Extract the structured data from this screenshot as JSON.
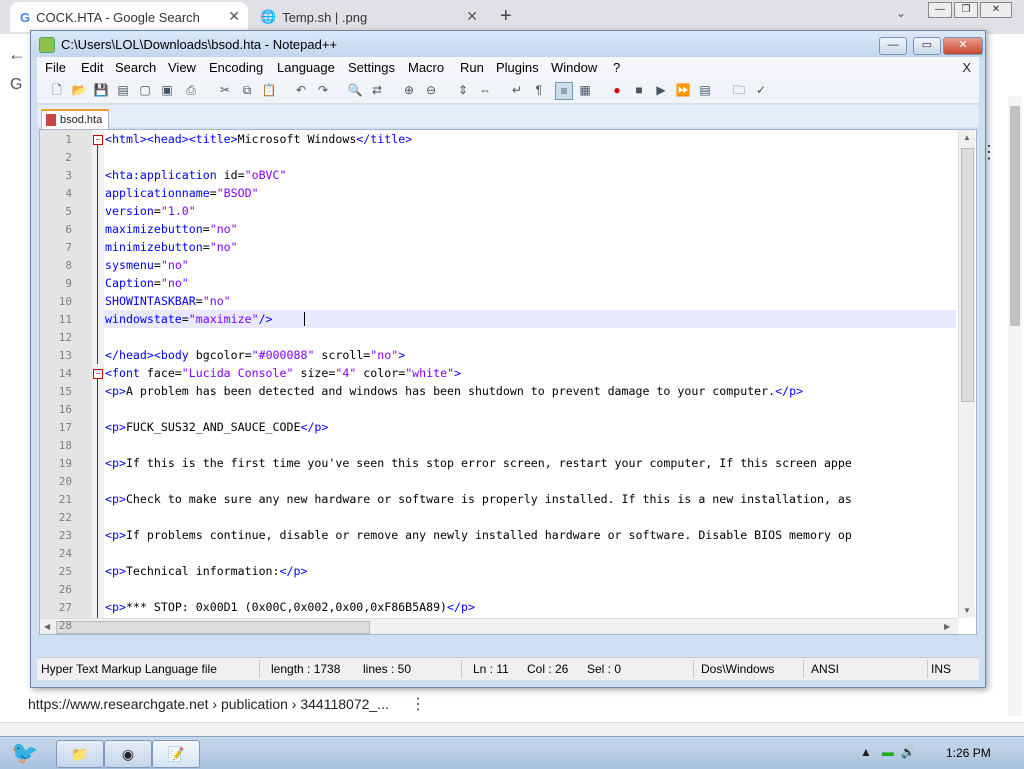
{
  "browser": {
    "tabs": [
      {
        "title": "COCK.HTA - Google Search",
        "icon": "google-g-icon"
      },
      {
        "title": "Temp.sh | .png",
        "icon": "globe-icon"
      }
    ],
    "new_tab": "+",
    "tab_search": "⌄",
    "result_url": "https://www.researchgate.net › publication › 344118072_...",
    "more": "⋮"
  },
  "npp": {
    "title": "C:\\Users\\LOL\\Downloads\\bsod.hta - Notepad++",
    "menu": [
      "File",
      "Edit",
      "Search",
      "View",
      "Encoding",
      "Language",
      "Settings",
      "Macro",
      "Run",
      "Plugins",
      "Window",
      "?"
    ],
    "menu_close": "X",
    "file_tab": "bsod.hta",
    "lines": [
      {
        "n": "1",
        "text": "<html><head><title>Microsoft Windows</title>"
      },
      {
        "n": "2",
        "text": ""
      },
      {
        "n": "3",
        "text": "<hta:application id=\"oBVC\""
      },
      {
        "n": "4",
        "text": "applicationname=\"BSOD\""
      },
      {
        "n": "5",
        "text": "version=\"1.0\""
      },
      {
        "n": "6",
        "text": "maximizebutton=\"no\""
      },
      {
        "n": "7",
        "text": "minimizebutton=\"no\""
      },
      {
        "n": "8",
        "text": "sysmenu=\"no\""
      },
      {
        "n": "9",
        "text": "Caption=\"no\""
      },
      {
        "n": "10",
        "text": "SHOWINTASKBAR=\"no\""
      },
      {
        "n": "11",
        "text": "windowstate=\"maximize\"/>"
      },
      {
        "n": "12",
        "text": ""
      },
      {
        "n": "13",
        "text": "</head><body bgcolor=\"#000088\" scroll=\"no\">"
      },
      {
        "n": "14",
        "text": "<font face=\"Lucida Console\" size=\"4\" color=\"white\">"
      },
      {
        "n": "15",
        "text": "<p>A problem has been detected and windows has been shutdown to prevent damage to your computer.</p>"
      },
      {
        "n": "16",
        "text": ""
      },
      {
        "n": "17",
        "text": "<p>FUCK_SUS32_AND_SAUCE_CODE</p>"
      },
      {
        "n": "18",
        "text": ""
      },
      {
        "n": "19",
        "text": "<p>If this is the first time you've seen this stop error screen, restart your computer, If this screen appe"
      },
      {
        "n": "20",
        "text": ""
      },
      {
        "n": "21",
        "text": "<p>Check to make sure any new hardware or software is properly installed. If this is a new installation, as"
      },
      {
        "n": "22",
        "text": ""
      },
      {
        "n": "23",
        "text": "<p>If problems continue, disable or remove any newly installed hardware or software. Disable BIOS memory op"
      },
      {
        "n": "24",
        "text": ""
      },
      {
        "n": "25",
        "text": "<p>Technical information:</p>"
      },
      {
        "n": "26",
        "text": ""
      },
      {
        "n": "27",
        "text": "<p>*** STOP: 0x00D1 (0x00C,0x002,0x00,0xF86B5A89)</p>"
      },
      {
        "n": "28",
        "text": ""
      }
    ],
    "status": {
      "language": "Hyper Text Markup Language file",
      "length": "length : 1738",
      "lines": "lines : 50",
      "ln": "Ln : 11",
      "col": "Col : 26",
      "sel": "Sel : 0",
      "eol": "Dos\\Windows",
      "encoding": "ANSI",
      "mode": "INS"
    }
  },
  "taskbar": {
    "clock": "1:26 PM",
    "tray_icons": [
      "expand-tray-icon",
      "network-icon",
      "volume-icon"
    ]
  }
}
